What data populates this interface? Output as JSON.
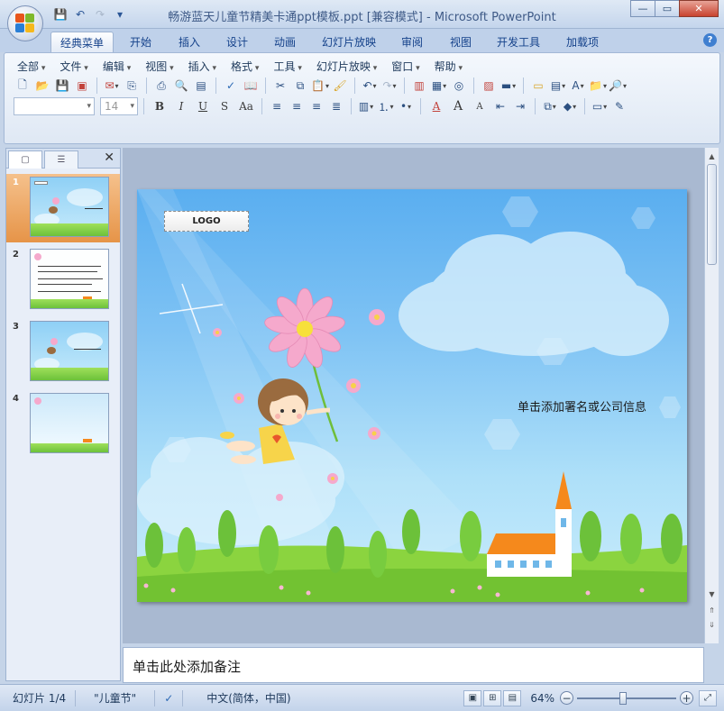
{
  "window": {
    "title": "畅游蓝天儿童节精美卡通ppt模板.ppt [兼容模式] - Microsoft PowerPoint",
    "minimize": "—",
    "restore": "▭",
    "close": "✕"
  },
  "qat": {
    "save": "💾",
    "undo": "↶",
    "redo": "↷",
    "customize": "▾"
  },
  "tabs": [
    {
      "label": "经典菜单",
      "active": true
    },
    {
      "label": "开始"
    },
    {
      "label": "插入"
    },
    {
      "label": "设计"
    },
    {
      "label": "动画"
    },
    {
      "label": "幻灯片放映"
    },
    {
      "label": "审阅"
    },
    {
      "label": "视图"
    },
    {
      "label": "开发工具"
    },
    {
      "label": "加载项"
    }
  ],
  "help": "?",
  "menus": [
    "全部",
    "文件",
    "编辑",
    "视图",
    "插入",
    "格式",
    "工具",
    "幻灯片放映",
    "窗口",
    "帮助"
  ],
  "font_size": "14",
  "format_buttons": {
    "bold": "B",
    "italic": "I",
    "underline": "U",
    "shadow": "S",
    "case": "Aa"
  },
  "font_color": "A",
  "grow": "A",
  "shrink": "A",
  "left_panel": {
    "tab_slides": "▢",
    "tab_outline": "☰",
    "close": "✕",
    "thumbs": [
      {
        "num": "1",
        "selected": true
      },
      {
        "num": "2"
      },
      {
        "num": "3"
      },
      {
        "num": "4"
      }
    ]
  },
  "slide": {
    "logo": "LOGO",
    "text": "单击添加署名或公司信息"
  },
  "notes": {
    "placeholder": "单击此处添加备注"
  },
  "status": {
    "slide": "幻灯片 1/4",
    "theme": "\"儿童节\"",
    "language": "中文(简体，中国)",
    "zoom": "64%",
    "zoom_out": "−",
    "zoom_in": "+",
    "zoom_level": 0.46
  },
  "colors": {
    "sky_top": "#5aaef0",
    "sky_bottom": "#c9ecfb",
    "grass": "#8bd43f",
    "church_roof": "#f5891c",
    "flower_pink": "#f5a9cc",
    "selected_thumb": "#e69448"
  }
}
